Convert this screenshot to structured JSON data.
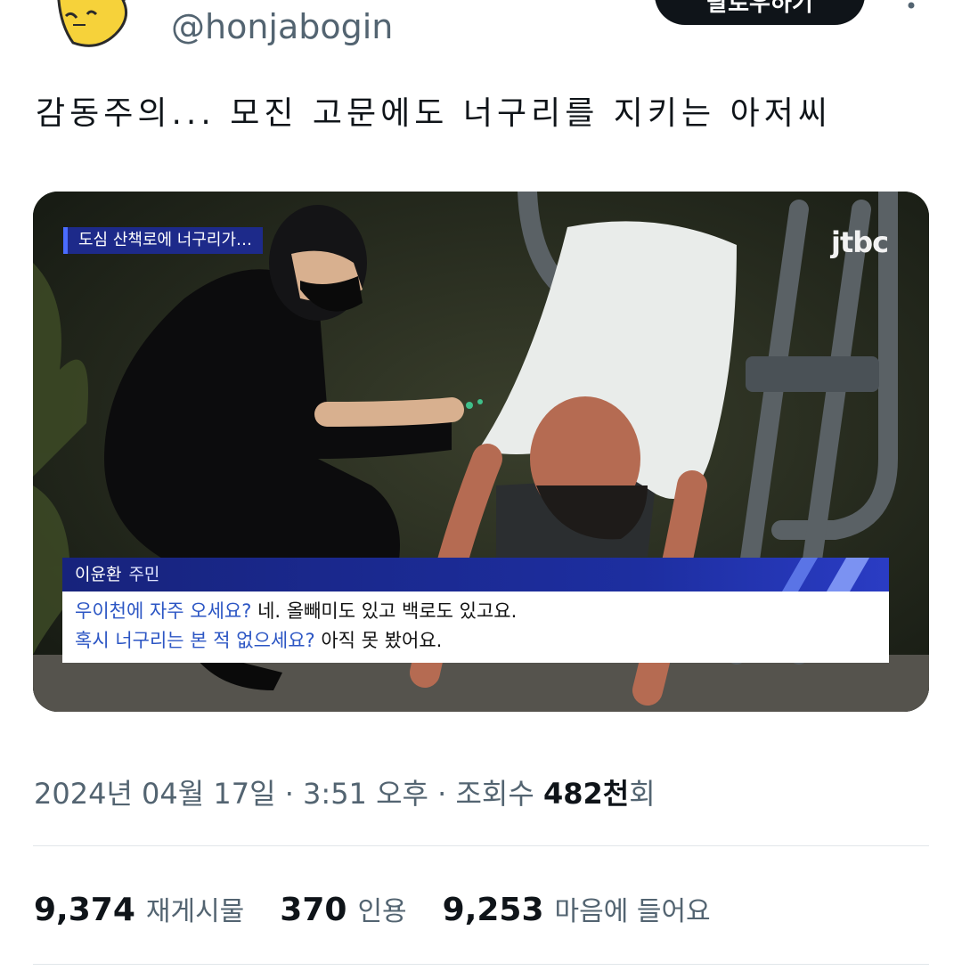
{
  "header": {
    "handle": "@honjabogin",
    "follow_label": "팔로우하기",
    "avatar_icon": "yellow-cartoon-avatar",
    "more_icon": "more-dots-icon"
  },
  "tweet": {
    "text": "감동주의... 모진 고문에도 너구리를 지키는 아저씨"
  },
  "media": {
    "news_title": "도심 산책로에 너구리가…",
    "channel": "jtbc",
    "speaker_name": "이윤환",
    "speaker_role": "주민",
    "line1_question": "우이천에 자주 오세요?",
    "line1_answer": " 네. 올빼미도 있고 백로도 있고요.",
    "line2_question": "혹시 너구리는 본 적 없으세요?",
    "line2_answer": " 아직 못 봤어요."
  },
  "meta": {
    "timestamp": "2024년 04월 17일 · 3:51 오후 · 조회수 ",
    "views": "482천",
    "views_suffix": "회"
  },
  "stats": {
    "retweets_count": "9,374",
    "retweets_label": "재게시물",
    "quotes_count": "370",
    "quotes_label": "인용",
    "likes_count": "9,253",
    "likes_label": "마음에 들어요"
  },
  "colors": {
    "accent": "#0f1419",
    "muted": "#536471",
    "news_blue": "#1d2a8a",
    "question_blue": "#2c56c4"
  }
}
